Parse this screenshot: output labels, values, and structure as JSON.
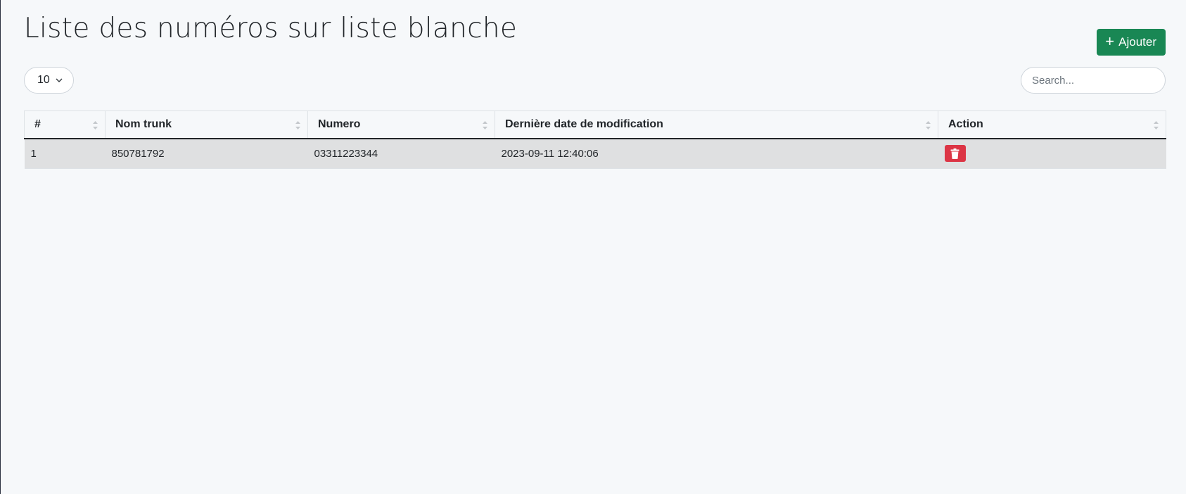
{
  "page": {
    "title": "Liste des numéros sur liste blanche"
  },
  "toolbar": {
    "add_label": "Ajouter",
    "page_length": "10",
    "search_placeholder": "Search..."
  },
  "table": {
    "columns": [
      "#",
      "Nom trunk",
      "Numero",
      "Dernière date de modification",
      "Action"
    ],
    "rows": [
      {
        "index": "1",
        "trunk": "850781792",
        "numero": "03311223344",
        "modified": "2023-09-11 12:40:06"
      }
    ]
  },
  "colors": {
    "add_button": "#198754",
    "delete_button": "#dc3545",
    "row_background": "#dfe0e1"
  },
  "icons": {
    "add": "plus-icon",
    "length": "chevron-down-icon",
    "sort": "sort-icon",
    "delete": "trash-icon"
  }
}
